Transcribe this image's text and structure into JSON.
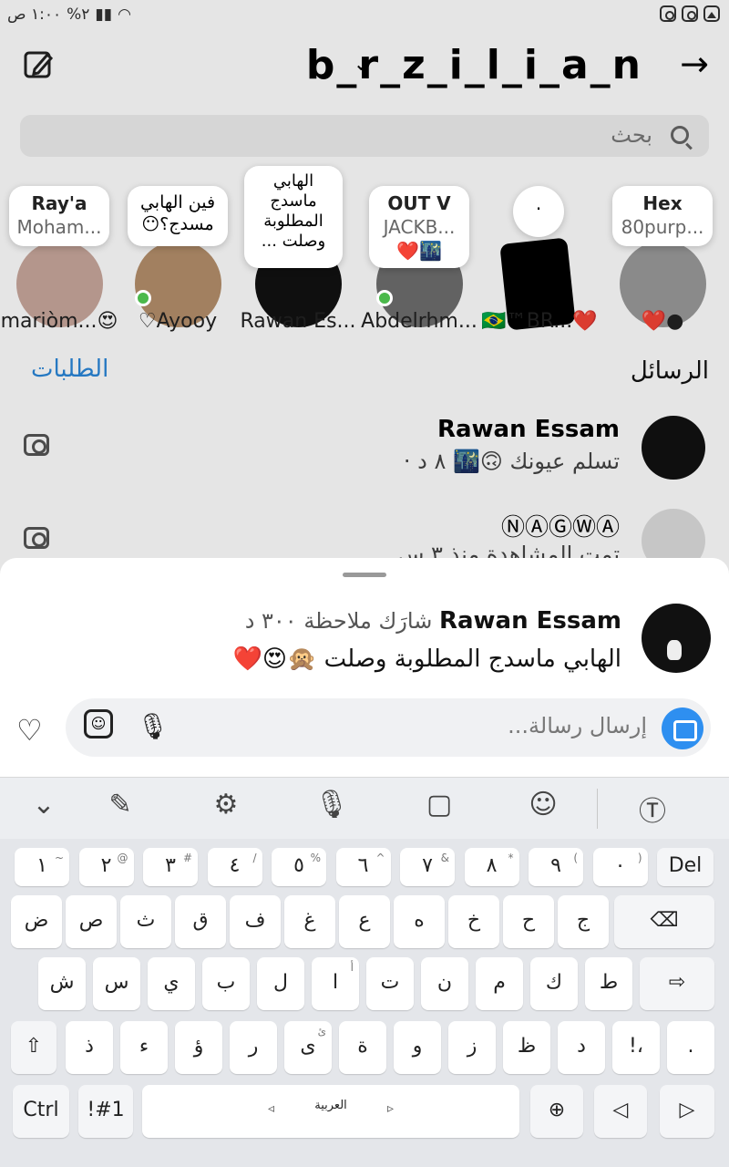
{
  "status_bar": {
    "time": "١:٠٠ ص",
    "battery": "%٢"
  },
  "header": {
    "title": "b_r_z_i_l_i_a_n"
  },
  "search": {
    "placeholder": "بحث"
  },
  "stories": [
    {
      "bubble_name": "Ray'a",
      "bubble_sub": "Moham...",
      "label": "mariòm...😍",
      "online": false
    },
    {
      "bubble_text": "فين الهابي مسدج؟😶",
      "label": "♡Ayooy",
      "online": true
    },
    {
      "bubble_text": "الهابي ماسدج المطلوبة وصلت ...",
      "label": "Rawan Es...",
      "online": false
    },
    {
      "bubble_name": "OUT V",
      "bubble_sub": "JACKB...",
      "bubble_extra": "❤️🌃",
      "label": "Abdelrhm...",
      "online": true
    },
    {
      "bubble_text": ".",
      "label": "🇧🇷™BR...❤️",
      "online": false
    },
    {
      "bubble_name": "Hex",
      "bubble_sub": "80purp...",
      "label": "❤️●",
      "online": false
    }
  ],
  "messages": {
    "section_title": "الرسائل",
    "requests_label": "الطلبات"
  },
  "threads": [
    {
      "name": "Rawan Essam",
      "preview": "تسلم عيونك 🙃🌃 ٨ د ·"
    },
    {
      "name": "ⓃⒶⒼⓌⒶ",
      "preview": "تمت المشاهدة منذ ٣ س"
    }
  ],
  "note_sheet": {
    "author": "Rawan Essam",
    "shared_text": "شارَك ملاحظة ٣٠٠ د",
    "note": "الهابي ماسدج المطلوبة وصلت 🙊😍❤️"
  },
  "composer": {
    "placeholder": "إرسال رسالة..."
  },
  "keyboard": {
    "row1": [
      {
        "k": "١",
        "s": "~"
      },
      {
        "k": "٢",
        "s": "@"
      },
      {
        "k": "٣",
        "s": "#"
      },
      {
        "k": "٤",
        "s": "/"
      },
      {
        "k": "٥",
        "s": "%"
      },
      {
        "k": "٦",
        "s": "^"
      },
      {
        "k": "٧",
        "s": "&"
      },
      {
        "k": "٨",
        "s": "*"
      },
      {
        "k": "٩",
        "s": "("
      },
      {
        "k": "٠",
        "s": ")"
      },
      {
        "k": "Del",
        "s": ""
      }
    ],
    "row2": [
      "ض",
      "ص",
      "ث",
      "ق",
      "ف",
      "غ",
      "ع",
      "ه",
      "خ",
      "ح",
      "ج"
    ],
    "row3": [
      "ش",
      "س",
      "ي",
      "ب",
      "ل",
      "ا",
      "ت",
      "ن",
      "م",
      "ك",
      "ط"
    ],
    "row4": [
      "ذ",
      "ء",
      "ؤ",
      "ر",
      "ى",
      "ة",
      "و",
      "ز",
      "ظ",
      "د",
      "!،",
      "."
    ],
    "row3_alef_sup": "أ",
    "row4_yeh_sup": "ئ",
    "ctrl": "Ctrl",
    "sym": "!#1",
    "space": "العربية"
  }
}
